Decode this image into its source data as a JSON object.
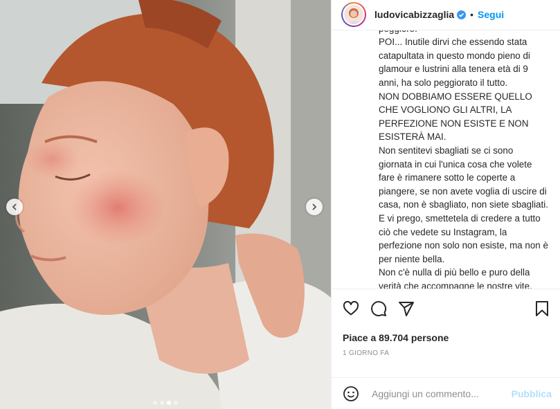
{
  "header": {
    "username": "ludovicabizzaglia",
    "separator": "•",
    "follow_label": "Segui"
  },
  "caption": {
    "text": "peggiore.\nPOI... Inutile dirvi che essendo stata catapultata in questo mondo pieno di glamour e lustrini alla tenera età di 9 anni, ha solo peggiorato il tutto.\nNON DOBBIAMO ESSERE QUELLO CHE VOGLIONO GLI ALTRI, LA PERFEZIONE NON ESISTE E NON ESISTERÀ MAI.\nNon sentitevi sbagliati se ci sono giornata in cui l'unica cosa che volete fare è rimanere sotto le coperte a piangere, se non avete voglia di uscire di casa, non è sbagliato, non siete sbagliati.\nE vi prego, smettetela di credere a tutto ciò che vedete su Instagram, la perfezione non solo non esiste, ma non è per niente bella.\nNon c'è nulla di più bello e puro della verità che accompagne le nostre vite, dopo il buio arriverà sempre la luce."
  },
  "actions": {
    "icons": [
      "heart-icon",
      "comment-icon",
      "share-icon",
      "bookmark-icon"
    ],
    "likes_text": "Piace a 89.704 persone",
    "time_text": "1 GIORNO FA"
  },
  "comment": {
    "placeholder": "Aggiungi un commento...",
    "publish_label": "Pubblica"
  },
  "carousel": {
    "slide_count": 4,
    "active_index": 2
  },
  "colors": {
    "accent": "#0095f6",
    "publish_disabled": "#b2dffc",
    "muted": "#8e8e8e"
  }
}
